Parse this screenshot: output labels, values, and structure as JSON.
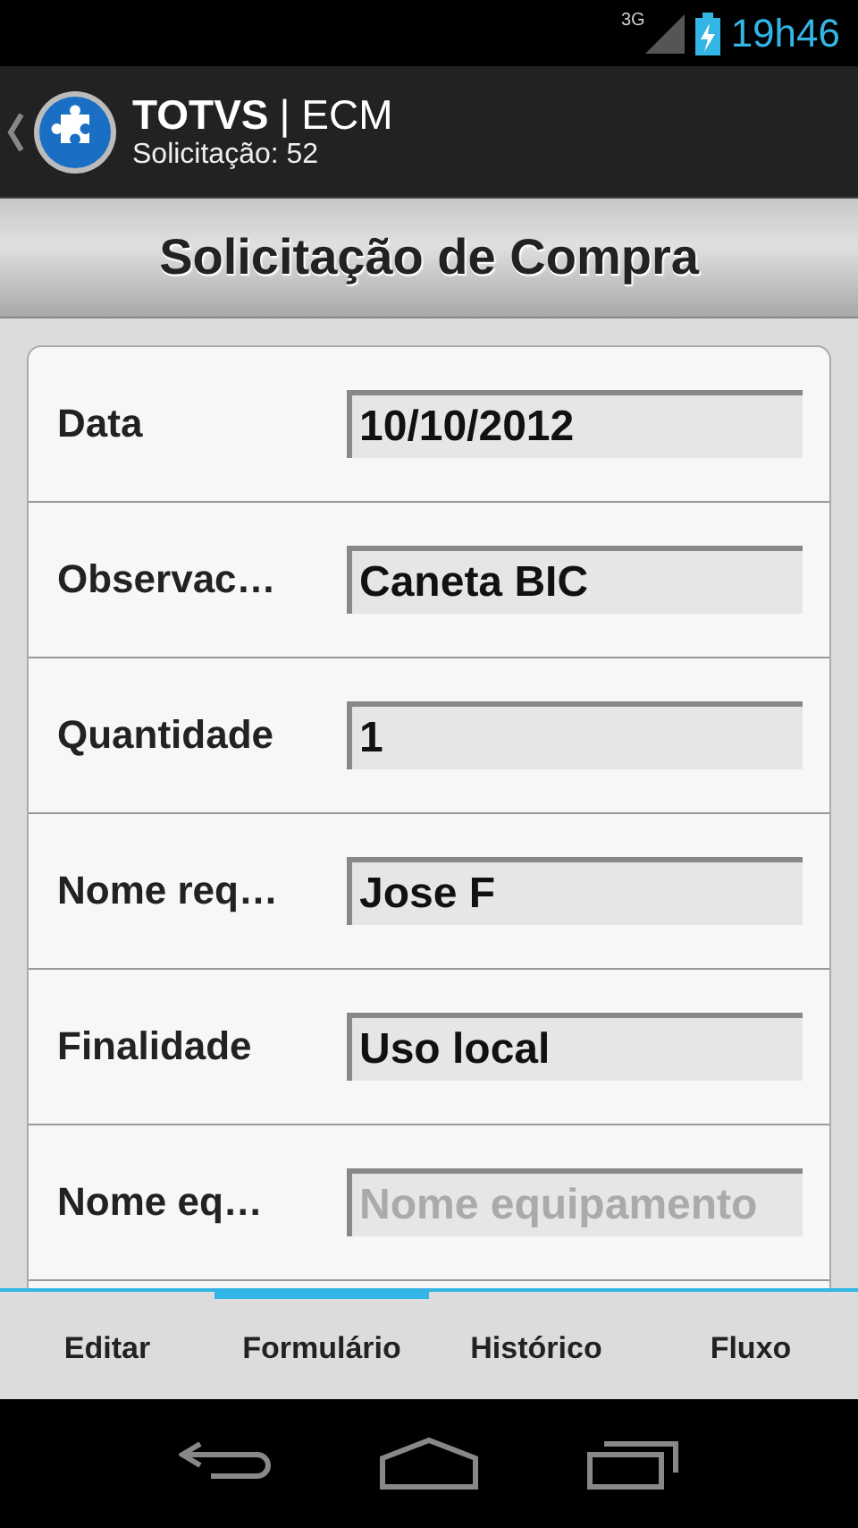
{
  "status_bar": {
    "network": "3G",
    "time": "19h46"
  },
  "action_bar": {
    "title_bold": "TOTVS",
    "title_rest": "| ECM",
    "subtitle": "Solicitação: 52"
  },
  "header": {
    "title": "Solicitação de Compra"
  },
  "fields": [
    {
      "label": "Data",
      "value": "10/10/2012"
    },
    {
      "label": "Observac…",
      "value": "Caneta BIC"
    },
    {
      "label": "Quantidade",
      "value": "1"
    },
    {
      "label": "Nome req…",
      "value": "Jose F"
    },
    {
      "label": "Finalidade",
      "value": "Uso local"
    },
    {
      "label": "Nome eq…",
      "placeholder": "Nome equipamento"
    }
  ],
  "tabs": [
    {
      "label": "Editar",
      "selected": false
    },
    {
      "label": "Formulário",
      "selected": true
    },
    {
      "label": "Histórico",
      "selected": false
    },
    {
      "label": "Fluxo",
      "selected": false
    }
  ]
}
